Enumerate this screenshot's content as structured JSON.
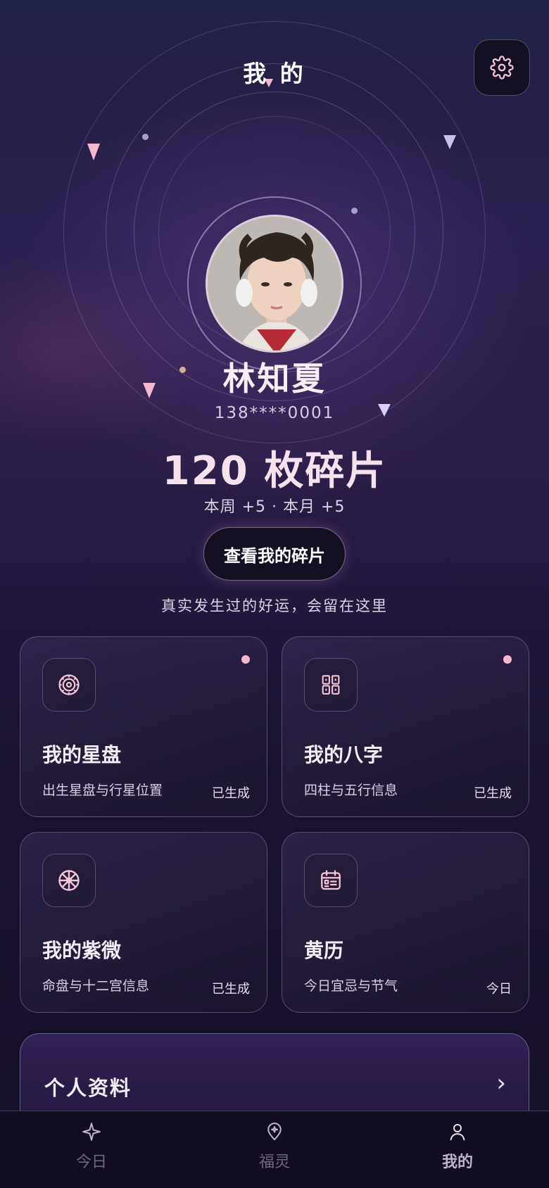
{
  "header": {
    "title": "我 的"
  },
  "profile": {
    "name": "林知夏",
    "phone": "138****0001",
    "shards_text": "120 枚碎片",
    "stats_text": "本周 +5 · 本月 +5",
    "view_button": "查看我的碎片",
    "tagline": "真实发生过的好运，会留在这里"
  },
  "cards": [
    {
      "title": "我的星盘",
      "desc": "出生星盘与行星位置",
      "status": "已生成",
      "icon": "astrolabe-icon",
      "has_dot": true
    },
    {
      "title": "我的八字",
      "desc": "四柱与五行信息",
      "status": "已生成",
      "icon": "grid-icon",
      "has_dot": true
    },
    {
      "title": "我的紫微",
      "desc": "命盘与十二宫信息",
      "status": "已生成",
      "icon": "wheel-icon",
      "has_dot": false
    },
    {
      "title": "黄历",
      "desc": "今日宜忌与节气",
      "status": "今日",
      "icon": "calendar-icon",
      "has_dot": false
    }
  ],
  "profile_section": {
    "title": "个人资料",
    "arrow": "›"
  },
  "tabs": [
    {
      "label": "今日",
      "icon": "sparkle-icon",
      "active": false
    },
    {
      "label": "福灵",
      "icon": "location-pin-icon",
      "active": false
    },
    {
      "label": "我的",
      "icon": "user-icon",
      "active": true
    }
  ],
  "colors": {
    "accent_pink": "#f7b7cf",
    "card_icon_stroke": "#f4c6d8",
    "tab_inactive": "#6f6880",
    "tab_active": "#bdb6c8"
  }
}
